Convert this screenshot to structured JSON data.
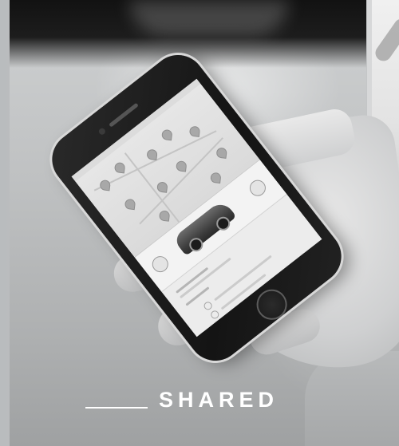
{
  "caption": {
    "label": "SHARED"
  },
  "photo": {
    "subject": "hand-holding-smartphone",
    "tone": "grayscale"
  },
  "colors": {
    "caption_text": "#ffffff",
    "background": "#bfc2c3"
  }
}
